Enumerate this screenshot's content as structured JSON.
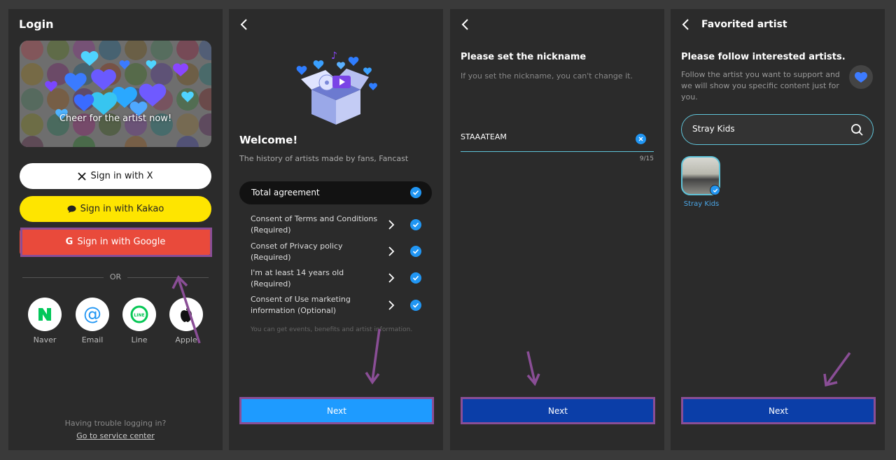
{
  "login": {
    "title": "Login",
    "banner_caption": "Cheer for the artist now!",
    "sign_in_x": "Sign in with X",
    "sign_in_kakao": "Sign in with Kakao",
    "sign_in_google": "Sign in with Google",
    "or": "OR",
    "social": [
      {
        "label": "Naver",
        "icon": "naver-icon"
      },
      {
        "label": "Email",
        "icon": "email-at-icon"
      },
      {
        "label": "Line",
        "icon": "line-icon"
      },
      {
        "label": "Apple",
        "icon": "apple-icon"
      }
    ],
    "trouble": "Having trouble logging in?",
    "service_center": "Go to service center"
  },
  "welcome": {
    "title": "Welcome!",
    "subtitle": "The history of artists made by fans, Fancast",
    "total_agreement": "Total agreement",
    "consents": [
      {
        "line1": "Consent of Terms and Conditions",
        "line2": "(Required)"
      },
      {
        "line1": "Conset of Privacy policy",
        "line2": "(Required)"
      },
      {
        "line1": "I'm at least 14 years old",
        "line2": "(Required)"
      },
      {
        "line1": "Consent of Use marketing",
        "line2": "information (Optional)"
      }
    ],
    "note": "You can get events, benefits and artist information.",
    "next": "Next"
  },
  "nickname": {
    "title": "Please set the nickname",
    "subtitle": "If you set the nickname, you can't change it.",
    "value": "STAAATEAM",
    "counter": "9/15",
    "next": "Next"
  },
  "favorite": {
    "header": "Favorited artist",
    "title": "Please follow interested artists.",
    "subtitle": "Follow the artist you want to support and we will show you specific content just for you.",
    "search_value": "Stray Kids",
    "artist_name": "Stray Kids",
    "next": "Next"
  },
  "colors": {
    "next_light": "#1e9bff",
    "next_dark": "#0b3ea8",
    "highlight": "#8a4e96",
    "google": "#e94a3b",
    "kakao": "#fee500"
  }
}
